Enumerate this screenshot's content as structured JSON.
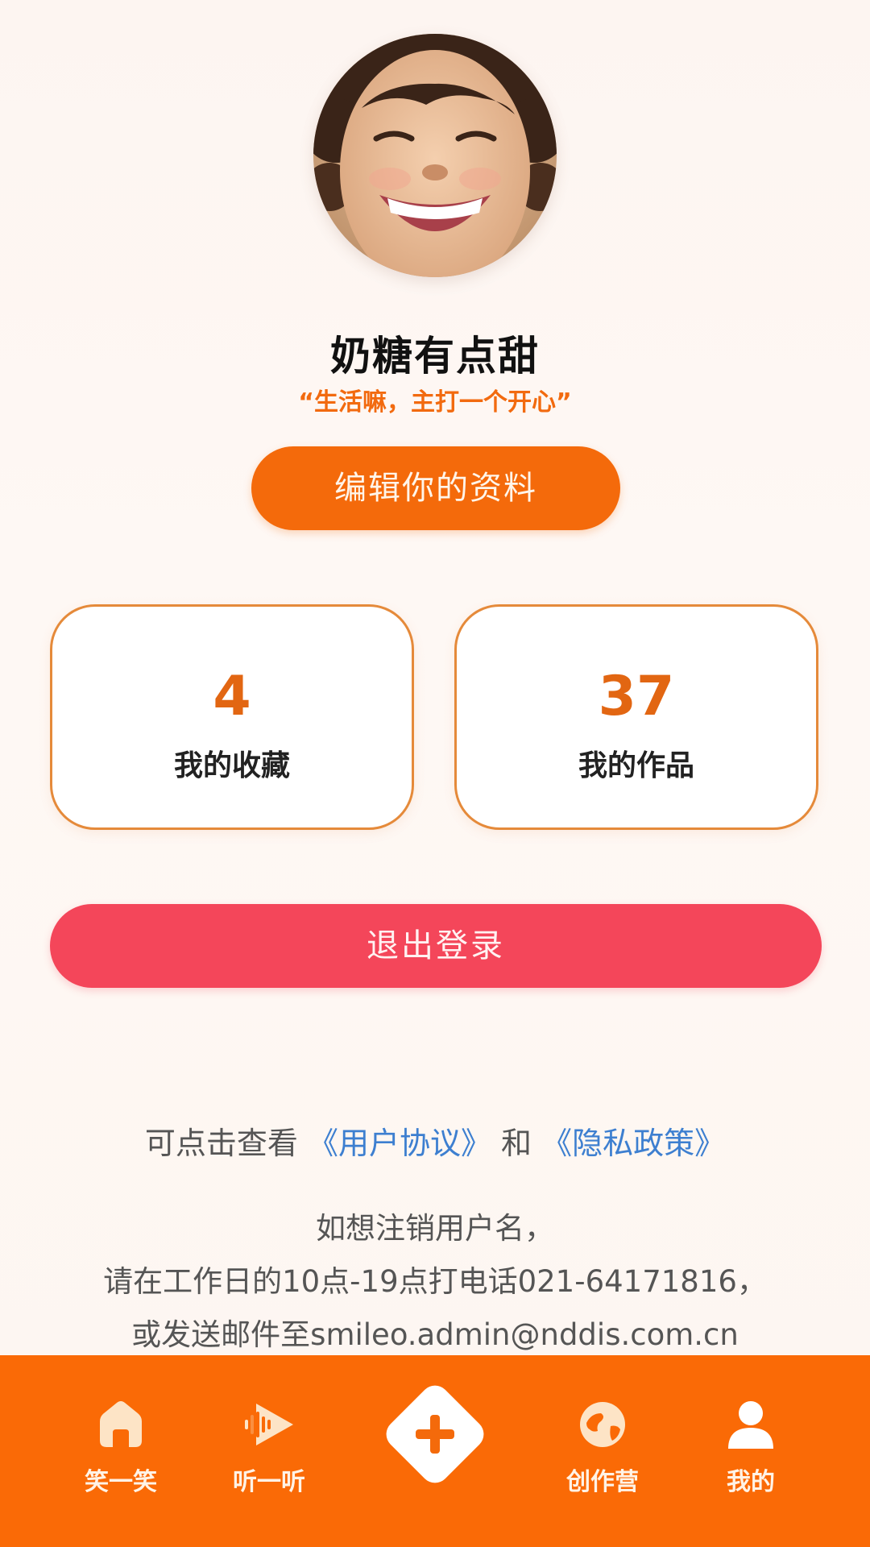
{
  "profile": {
    "username": "奶糖有点甜",
    "motto": "“生活嘛，主打一个开心”",
    "edit_label": "编辑你的资料"
  },
  "stats": {
    "favorites_count": "4",
    "favorites_label": "我的收藏",
    "works_count": "37",
    "works_label": "我的作品"
  },
  "logout_label": "退出登录",
  "agreement": {
    "prefix": "可点击查看 ",
    "user_agreement": "《用户协议》",
    "and": " 和 ",
    "privacy_policy": "《隐私政策》"
  },
  "notice": {
    "line1": "如想注销用户名，",
    "line2": "请在工作日的10点-19点打电话021-64171816，",
    "line3": "或发送邮件至smileo.admin@nddis.com.cn"
  },
  "tabbar": {
    "home_label": "笑一笑",
    "listen_label": "听一听",
    "camp_label": "创作营",
    "mine_label": "我的",
    "home_icon": "home-icon",
    "listen_icon": "audio-play-icon",
    "add_icon": "plus-diamond-icon",
    "camp_icon": "globe-icon",
    "mine_icon": "person-icon"
  },
  "colors": {
    "accent": "#f46a0b",
    "motto": "#f26a0f",
    "logout": "#f4465a",
    "link": "#3d7fd0",
    "tabbar": "#fa6a06"
  }
}
